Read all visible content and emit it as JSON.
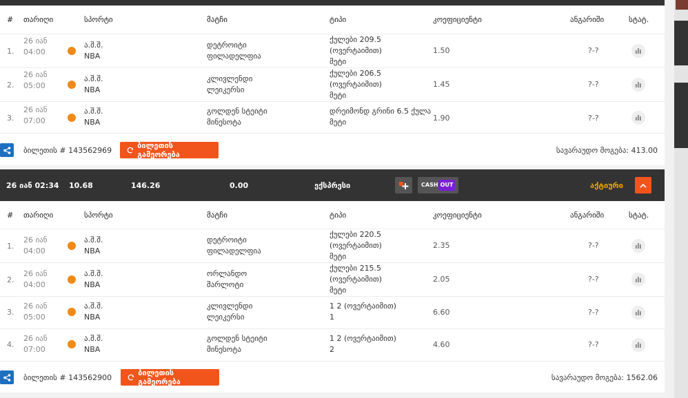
{
  "headers": [
    "#",
    "თარიღი",
    "სპორტი",
    "მატჩი",
    "ტიპი",
    "კოეფიციენტი",
    "ანგარიში",
    "სტატ."
  ],
  "ticket1": {
    "rows": [
      {
        "num": "1.",
        "date1": "26 იან",
        "date2": "04:00",
        "sport1": "ა.შ.შ.",
        "sport2": "NBA",
        "team1": "დეტროიტი",
        "team2": "ფილადელფია",
        "type1": "ქულები 209.5",
        "type2": "(ოვერტაიმით)",
        "type3": "მეტი",
        "odd": "1.50",
        "score": "?-?"
      },
      {
        "num": "2.",
        "date1": "26 იან",
        "date2": "05:00",
        "sport1": "ა.შ.შ.",
        "sport2": "NBA",
        "team1": "კლივლენდი",
        "team2": "ლეიკერსი",
        "type1": "ქულები 206.5",
        "type2": "(ოვერტაიმით)",
        "type3": "მეტი",
        "odd": "1.45",
        "score": "?-?"
      },
      {
        "num": "3.",
        "date1": "26 იან",
        "date2": "07:00",
        "sport1": "ა.შ.შ.",
        "sport2": "NBA",
        "team1": "გოლდენ სტეიტი",
        "team2": "მინესოტა",
        "type1": "დრეიმონდ გრინი 6.5 ქულა",
        "type2": "მეტი",
        "odd": "1.90",
        "score": "?-?"
      }
    ],
    "ticket_label": "ბილეთის # 143562969",
    "repeat_label": "ბილეთის გამეორება",
    "total": "სავარაუდო მოგება: 413.00"
  },
  "ticket2_bar": {
    "date": "26 იან 02:34",
    "odds": "10.68",
    "win": "146.26",
    "cashout_amount": "0.00",
    "bet_type": "ექსპრესი",
    "cash_label": "CASH",
    "out_label": "OUT",
    "status": "აქტიური"
  },
  "ticket2": {
    "rows": [
      {
        "num": "1.",
        "date1": "26 იან",
        "date2": "04:00",
        "sport1": "ა.შ.შ.",
        "sport2": "NBA",
        "team1": "დეტროიტი",
        "team2": "ფილადელფია",
        "type1": "ქულები 220.5",
        "type2": "(ოვერტაიმით)",
        "type3": "მეტი",
        "odd": "2.35",
        "score": "?-?"
      },
      {
        "num": "2.",
        "date1": "26 იან",
        "date2": "04:00",
        "sport1": "ა.შ.შ.",
        "sport2": "NBA",
        "team1": "ორლანდო",
        "team2": "შარლოტი",
        "type1": "ქულები 215.5",
        "type2": "(ოვერტაიმით)",
        "type3": "მეტი",
        "odd": "2.05",
        "score": "?-?"
      },
      {
        "num": "3.",
        "date1": "26 იან",
        "date2": "05:00",
        "sport1": "ა.შ.შ.",
        "sport2": "NBA",
        "team1": "კლივლენდი",
        "team2": "ლეიკერსი",
        "type1": "1 2 (ოვერტაიმით)",
        "type2": "1",
        "odd": "6.60",
        "score": "?-?"
      },
      {
        "num": "4.",
        "date1": "26 იან",
        "date2": "07:00",
        "sport1": "ა.შ.შ.",
        "sport2": "NBA",
        "team1": "გოლდენ სტეიტი",
        "team2": "მინესოტა",
        "type1": "1 2 (ოვერტაიმით)",
        "type2": "2",
        "odd": "4.60",
        "score": "?-?"
      }
    ],
    "ticket_label": "ბილეთის # 143562900",
    "repeat_label": "ბილეთის გამეორება",
    "total": "სავარაუდო მოგება: 1562.06"
  },
  "icons": {
    "share": "share-icon",
    "repeat": "refresh-icon",
    "stats": "bar-chart-icon",
    "add": "plus-icon",
    "collapse": "chevron-up-icon"
  },
  "colors": {
    "accent": "#f1551c",
    "status": "#f5a400",
    "share": "#1e6fbf",
    "cashout": "#7b1fd6",
    "ball": "#f08a17"
  }
}
